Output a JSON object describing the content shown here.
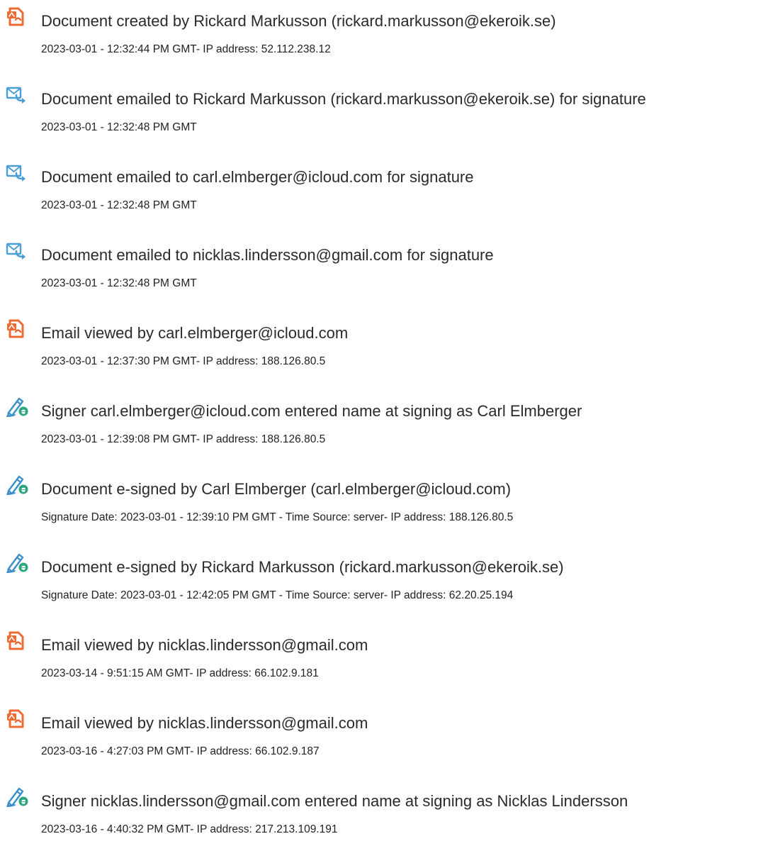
{
  "colors": {
    "doc_icon": "#ef6a35",
    "mail_icon": "#4a9fd9",
    "pen_icon": "#3c8fcb",
    "esign_badge": "#2aa57d",
    "title_text": "#2a2a2a",
    "detail_text": "#222222"
  },
  "entries": [
    {
      "icon": "document-icon",
      "title": "Document created by Rickard Markusson (rickard.markusson@ekeroik.se)",
      "detail": "2023-03-01 - 12:32:44 PM GMT- IP address: 52.112.238.12"
    },
    {
      "icon": "email-sent-icon",
      "title": "Document emailed to Rickard Markusson (rickard.markusson@ekeroik.se) for signature",
      "detail": "2023-03-01 - 12:32:48 PM GMT"
    },
    {
      "icon": "email-sent-icon",
      "title": "Document emailed to carl.elmberger@icloud.com for signature",
      "detail": "2023-03-01 - 12:32:48 PM GMT"
    },
    {
      "icon": "email-sent-icon",
      "title": "Document emailed to nicklas.lindersson@gmail.com for signature",
      "detail": "2023-03-01 - 12:32:48 PM GMT"
    },
    {
      "icon": "document-icon",
      "title": "Email viewed by carl.elmberger@icloud.com",
      "detail": "2023-03-01 - 12:37:30 PM GMT- IP address: 188.126.80.5"
    },
    {
      "icon": "esign-pen-icon",
      "title": "Signer carl.elmberger@icloud.com entered name at signing as Carl Elmberger",
      "detail": "2023-03-01 - 12:39:08 PM GMT- IP address: 188.126.80.5"
    },
    {
      "icon": "esign-pen-icon",
      "title": "Document e-signed by Carl Elmberger (carl.elmberger@icloud.com)",
      "detail": "Signature Date: 2023-03-01 - 12:39:10 PM GMT - Time Source: server- IP address: 188.126.80.5"
    },
    {
      "icon": "esign-pen-icon",
      "title": "Document e-signed by Rickard Markusson (rickard.markusson@ekeroik.se)",
      "detail": "Signature Date: 2023-03-01 - 12:42:05 PM GMT - Time Source: server- IP address: 62.20.25.194"
    },
    {
      "icon": "document-icon",
      "title": "Email viewed by nicklas.lindersson@gmail.com",
      "detail": "2023-03-14 - 9:51:15 AM GMT- IP address: 66.102.9.181"
    },
    {
      "icon": "document-icon",
      "title": "Email viewed by nicklas.lindersson@gmail.com",
      "detail": "2023-03-16 - 4:27:03 PM GMT- IP address: 66.102.9.187"
    },
    {
      "icon": "esign-pen-icon",
      "title": "Signer nicklas.lindersson@gmail.com entered name at signing as Nicklas Lindersson",
      "detail": "2023-03-16 - 4:40:32 PM GMT- IP address: 217.213.109.191"
    }
  ]
}
